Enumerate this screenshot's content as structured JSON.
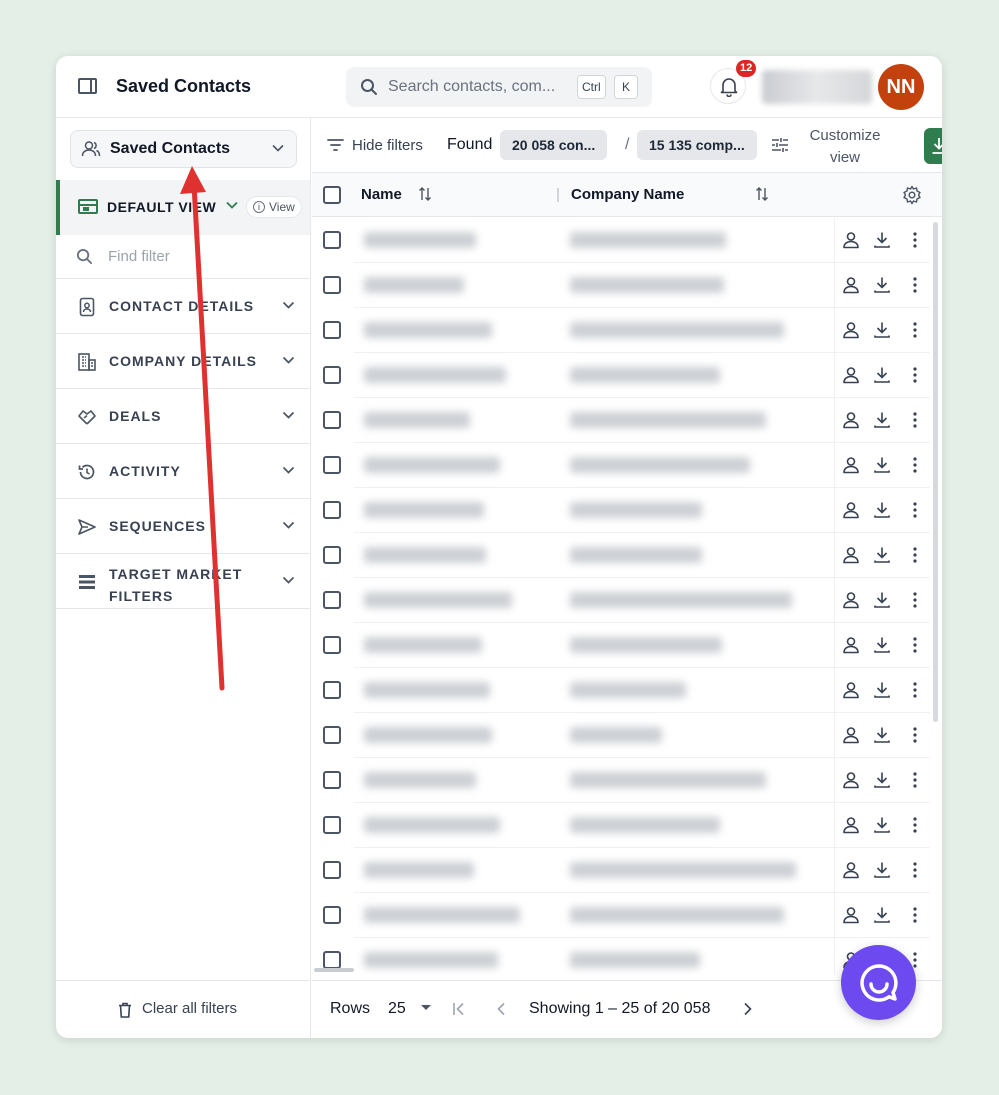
{
  "header": {
    "title": "Saved Contacts",
    "search_placeholder": "Search contacts, com...",
    "shortcut_ctrl": "Ctrl",
    "shortcut_key": "K",
    "notification_count": "12",
    "avatar_initials": "NN"
  },
  "sidebar": {
    "saved_dropdown_label": "Saved Contacts",
    "view_label": "DEFAULT VIEW",
    "view_pill": "View",
    "find_filter_placeholder": "Find filter",
    "sections": [
      {
        "label": "CONTACT DETAILS",
        "icon": "contact-card-icon"
      },
      {
        "label": "COMPANY DETAILS",
        "icon": "building-icon"
      },
      {
        "label": "DEALS",
        "icon": "handshake-icon"
      },
      {
        "label": "ACTIVITY",
        "icon": "history-icon"
      },
      {
        "label": "SEQUENCES",
        "icon": "send-icon"
      },
      {
        "label": "TARGET MARKET FILTERS",
        "icon": "list-icon"
      }
    ],
    "clear_filters": "Clear all filters"
  },
  "toolbar": {
    "hide_filters": "Hide filters",
    "found_label": "Found",
    "contacts_chip": "20 058 con...",
    "separator": "/",
    "companies_chip": "15 135 comp...",
    "customize_view": "Customize view"
  },
  "table": {
    "columns": [
      "Name",
      "Company Name"
    ],
    "row_count_visible": 17
  },
  "footer": {
    "rows_label": "Rows",
    "rows_value": "25",
    "showing": "Showing 1 – 25 of 20 058"
  },
  "colors": {
    "accent_green": "#2f7d4f",
    "avatar": "#c2410c",
    "badge": "#dc2626",
    "chat": "#6d4af0",
    "annotation_arrow": "#e03131"
  }
}
